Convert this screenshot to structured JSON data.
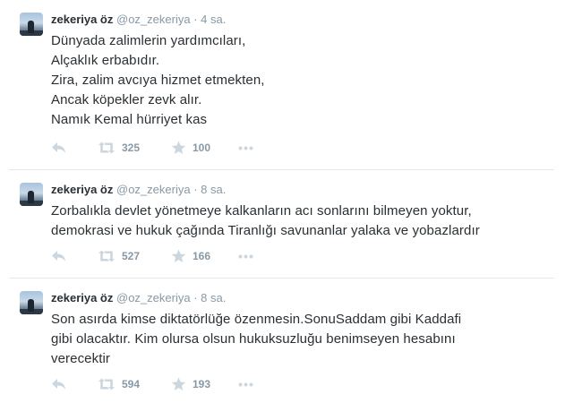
{
  "tweets": [
    {
      "fullname": "zekeriya öz",
      "username": "@oz_zekeriya",
      "dot": "·",
      "time": "4 sa.",
      "text": "Dünyada zalimlerin yardımcıları,\nAlçaklık erbabıdır.\nZira, zalim avcıya hizmet etmekten,\nAncak köpekler zevk alır.\nNamık Kemal hürriyet kas",
      "retweets": "325",
      "favorites": "100"
    },
    {
      "fullname": "zekeriya öz",
      "username": "@oz_zekeriya",
      "dot": "·",
      "time": "8 sa.",
      "text": "Zorbalıkla devlet yönetmeye kalkanların acı sonlarını bilmeyen yoktur,\ndemokrasi ve hukuk çağında Tiranlığı savunanlar yalaka ve yobazlardır",
      "retweets": "527",
      "favorites": "166"
    },
    {
      "fullname": "zekeriya öz",
      "username": "@oz_zekeriya",
      "dot": "·",
      "time": "8 sa.",
      "text": "Son asırda kimse diktatörlüğe özenmesin.SonuSaddam gibi Kaddafi\ngibi olacaktır. Kim olursa olsun hukuksuzluğu benimseyen hesabını\nverecektir",
      "retweets": "594",
      "favorites": "193"
    }
  ],
  "icons": {
    "reply": "reply-icon",
    "retweet": "retweet-icon",
    "favorite": "star-icon",
    "more": "more-icon"
  },
  "colors": {
    "name": "#292f33",
    "meta": "#8899a6",
    "icon": "#ccd6dd",
    "divider": "#e1e8ed"
  }
}
